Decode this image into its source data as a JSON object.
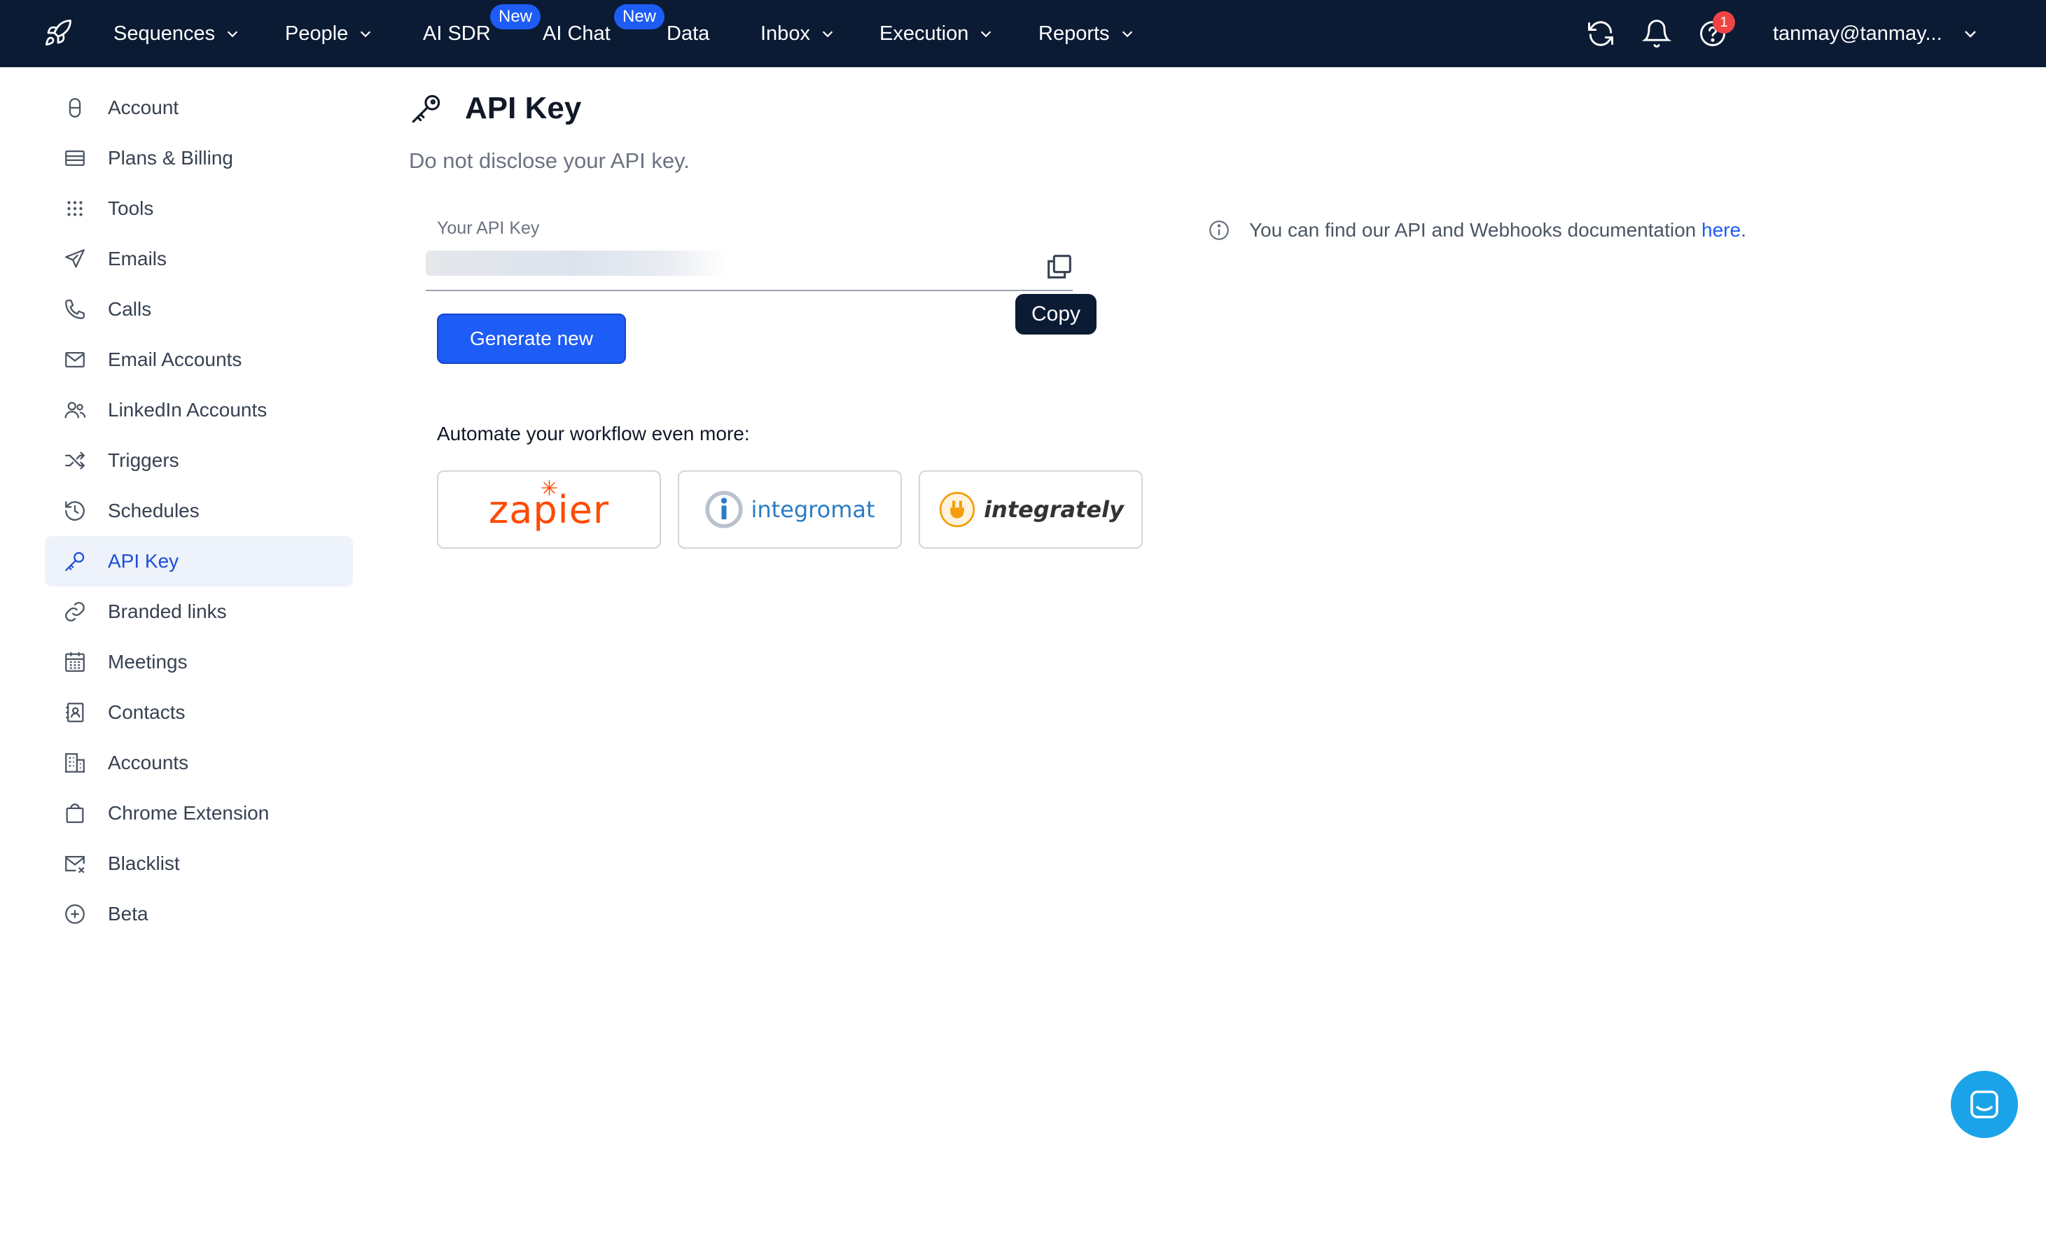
{
  "nav": {
    "items": [
      {
        "label": "Sequences",
        "dropdown": true
      },
      {
        "label": "People",
        "dropdown": true
      },
      {
        "label": "AI SDR",
        "badge": "New"
      },
      {
        "label": "AI Chat",
        "badge": "New"
      },
      {
        "label": "Data"
      },
      {
        "label": "Inbox",
        "dropdown": true
      },
      {
        "label": "Execution",
        "dropdown": true
      },
      {
        "label": "Reports",
        "dropdown": true
      }
    ],
    "notification_count": "1",
    "user": "tanmay@tanmay..."
  },
  "sidebar": {
    "items": [
      {
        "label": "Account",
        "icon": "lock-icon"
      },
      {
        "label": "Plans & Billing",
        "icon": "credit-card-icon"
      },
      {
        "label": "Tools",
        "icon": "grid-dots-icon"
      },
      {
        "label": "Emails",
        "icon": "send-icon"
      },
      {
        "label": "Calls",
        "icon": "phone-icon"
      },
      {
        "label": "Email Accounts",
        "icon": "mail-icon"
      },
      {
        "label": "LinkedIn Accounts",
        "icon": "users-icon"
      },
      {
        "label": "Triggers",
        "icon": "shuffle-icon"
      },
      {
        "label": "Schedules",
        "icon": "history-icon"
      },
      {
        "label": "API Key",
        "icon": "key-icon",
        "active": true
      },
      {
        "label": "Branded links",
        "icon": "link-icon"
      },
      {
        "label": "Meetings",
        "icon": "calendar-icon"
      },
      {
        "label": "Contacts",
        "icon": "contact-book-icon"
      },
      {
        "label": "Accounts",
        "icon": "building-icon"
      },
      {
        "label": "Chrome Extension",
        "icon": "shopping-bag-icon"
      },
      {
        "label": "Blacklist",
        "icon": "mail-x-icon"
      },
      {
        "label": "Beta",
        "icon": "plus-circle-icon"
      }
    ]
  },
  "main": {
    "title": "API Key",
    "subtitle": "Do not disclose your API key.",
    "api_key_label": "Your API Key",
    "copy_tooltip": "Copy",
    "generate_label": "Generate new",
    "automate_label": "Automate your workflow even more:",
    "integrations": [
      "zapier",
      "integromat",
      "integrately"
    ],
    "doc_note": "You can find our API and Webhooks documentation ",
    "doc_link": "here",
    "doc_end": "."
  },
  "colors": {
    "nav_bg": "#0b1b34",
    "accent": "#1d5cf5",
    "active_bg": "#eef2fb"
  }
}
